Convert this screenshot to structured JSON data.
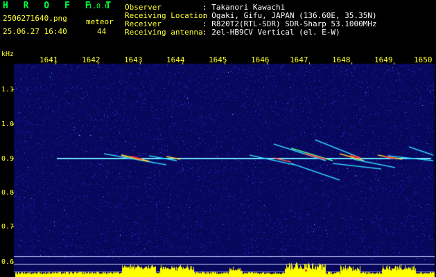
{
  "header": {
    "app_name": "H R O F F T",
    "version": "1.0.0",
    "filename": "2506271640.png",
    "meteor_label": "meteor",
    "datetime": "25.06.27 16:40",
    "meteor_count": "44",
    "info": [
      {
        "label": "Observer",
        "value": ": Takanori Kawachi"
      },
      {
        "label": "Receiving Location",
        "value": ": Ogaki, Gifu, JAPAN (136.60E, 35.35N)"
      },
      {
        "label": "Receiver",
        "value": ": R820T2(RTL-SDR) SDR-Sharp 53.1000MHz"
      },
      {
        "label": "Receiving antenna",
        "value": ": 2el-HB9CV Vertical (el. E-W)"
      }
    ]
  },
  "chart_data": {
    "type": "heatmap",
    "ylabel": "kHz",
    "x_ticks": [
      "1641",
      "1642",
      "1643",
      "1644",
      "1645",
      "1646",
      "1647",
      "1648",
      "1649",
      "1650"
    ],
    "y_ticks": [
      "1.1",
      "1.0",
      "0.9",
      "0.8",
      "0.7",
      "0.6"
    ],
    "carrier_khz": 0.9,
    "colors": {
      "carrier": "#30d0ff",
      "text": "#ffff33",
      "level": "#ffff00",
      "background": "#0a0a6a"
    }
  }
}
